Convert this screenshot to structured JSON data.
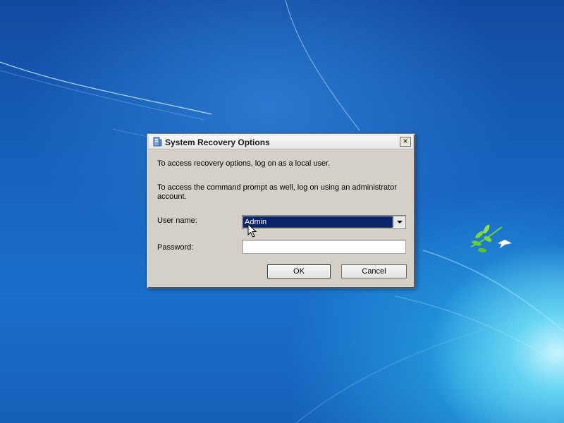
{
  "dialog": {
    "title": "System Recovery Options",
    "close_label": "×",
    "message_1": "To access recovery options, log on as a local user.",
    "message_2": "To access the command prompt as well, log on using an administrator account.",
    "user_name_label": "User name:",
    "user_name_value": "Admin",
    "password_label": "Password:",
    "password_value": "",
    "ok_label": "OK",
    "cancel_label": "Cancel"
  },
  "icons": [
    "recovery-icon",
    "close-icon",
    "chevron-down-icon",
    "mouse-pointer-icon",
    "dove-branch-icon"
  ],
  "colors": {
    "wallpaper_blue": "#1662bd",
    "dialog_face": "#d4d0c8",
    "selection": "#0a246a"
  }
}
